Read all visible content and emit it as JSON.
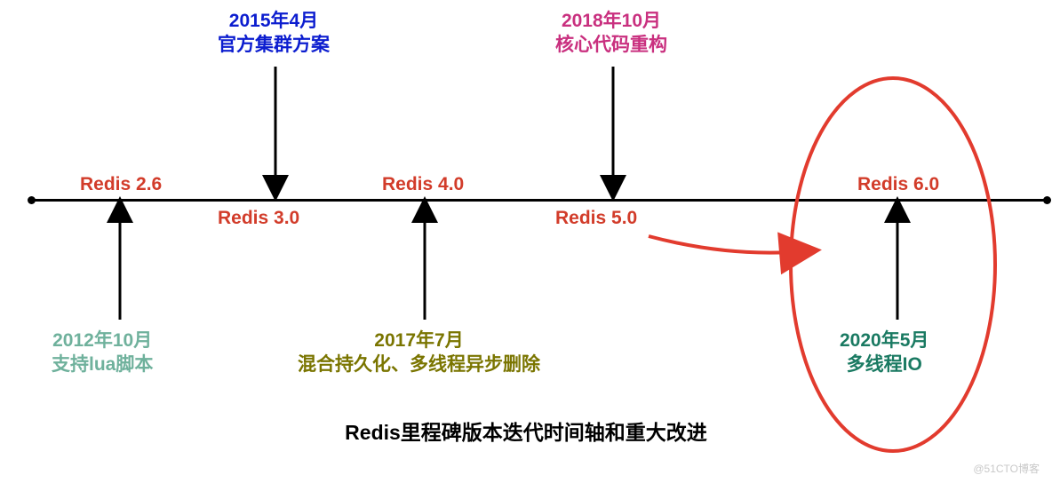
{
  "chart_data": {
    "type": "timeline",
    "title": "Redis里程碑版本迭代时间轴和重大改进",
    "events": [
      {
        "version": "Redis 2.6",
        "date": "2012年10月",
        "feature": "支持lua脚本"
      },
      {
        "version": "Redis 3.0",
        "date": "2015年4月",
        "feature": "官方集群方案"
      },
      {
        "version": "Redis 4.0",
        "date": "2017年7月",
        "feature": "混合持久化、多线程异步删除"
      },
      {
        "version": "Redis 5.0",
        "date": "2018年10月",
        "feature": "核心代码重构"
      },
      {
        "version": "Redis 6.0",
        "date": "2020年5月",
        "feature": "多线程IO",
        "highlighted": true
      }
    ]
  },
  "versions": {
    "v26": "Redis 2.6",
    "v30": "Redis 3.0",
    "v40": "Redis 4.0",
    "v50": "Redis 5.0",
    "v60": "Redis 6.0"
  },
  "annotations": {
    "a26_l1": "2012年10月",
    "a26_l2": "支持lua脚本",
    "a30_l1": "2015年4月",
    "a30_l2": "官方集群方案",
    "a40_l1": "2017年7月",
    "a40_l2": "混合持久化、多线程异步删除",
    "a50_l1": "2018年10月",
    "a50_l2": "核心代码重构",
    "a60_l1": "2020年5月",
    "a60_l2": "多线程IO"
  },
  "caption": "Redis里程碑版本迭代时间轴和重大改进",
  "watermark": "@51CTO博客",
  "colors": {
    "version": "#d23c2a",
    "a26": "#6fb19c",
    "a30": "#0c1dcf",
    "a40": "#7a7500",
    "a50": "#c9307f",
    "a60": "#1a7a62",
    "highlight": "#e23b2e"
  }
}
